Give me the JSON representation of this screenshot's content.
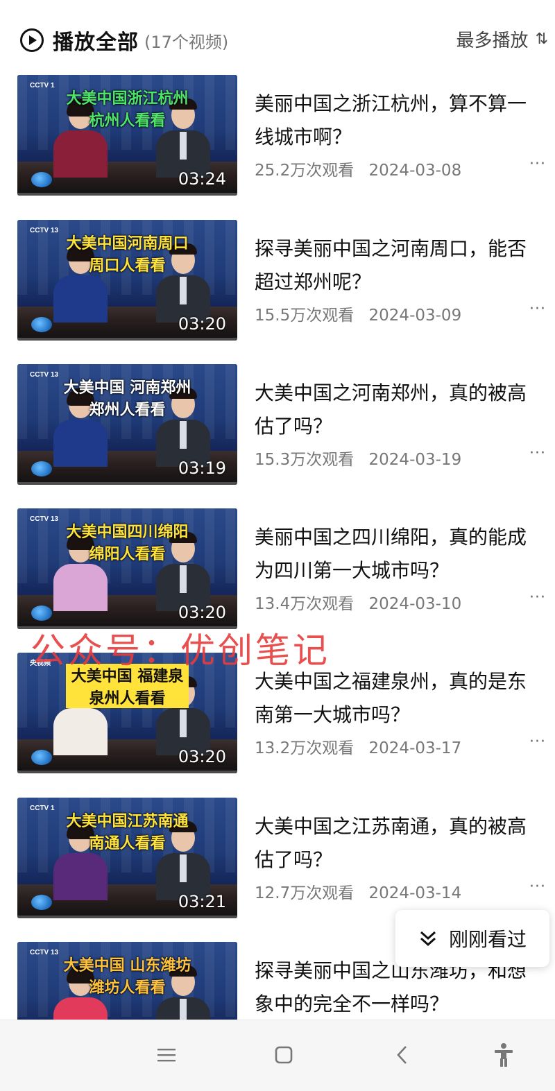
{
  "header": {
    "play_all_label": "播放全部",
    "count_label": "(17个视频)",
    "sort_label": "最多播放",
    "sort_icon": "⇅"
  },
  "videos": [
    {
      "title": "美丽中国之浙江杭州，算不算一线城市啊？",
      "views": "25.2万次观看",
      "date": "2024-03-08",
      "duration": "03:24",
      "caption_line1": "大美中国浙江杭州",
      "caption_line2": "杭州人看看",
      "caption_color": "#4ee66a",
      "channel": "CCTV 1",
      "anchor_color": "#8a1f3a"
    },
    {
      "title": "探寻美丽中国之河南周口，能否超过郑州呢？",
      "views": "15.5万次观看",
      "date": "2024-03-09",
      "duration": "03:20",
      "caption_line1": "大美中国河南周口",
      "caption_line2": "周口人看看",
      "caption_color": "#ffe23a",
      "channel": "CCTV 13",
      "anchor_color": "#1f3a8a"
    },
    {
      "title": "大美中国之河南郑州，真的被高估了吗？",
      "views": "15.3万次观看",
      "date": "2024-03-19",
      "duration": "03:19",
      "caption_line1": "大美中国 河南郑州",
      "caption_line2": "郑州人看看",
      "caption_color": "#ffffff",
      "channel": "CCTV 13",
      "anchor_color": "#1f3a8a"
    },
    {
      "title": "美丽中国之四川绵阳，真的能成为四川第一大城市吗？",
      "views": "13.4万次观看",
      "date": "2024-03-10",
      "duration": "03:20",
      "caption_line1": "大美中国四川绵阳",
      "caption_line2": "绵阳人看看",
      "caption_color": "#ffe23a",
      "channel": "CCTV 13",
      "anchor_color": "#d9a6d6"
    },
    {
      "title": "大美中国之福建泉州，真的是东南第一大城市吗？",
      "views": "13.2万次观看",
      "date": "2024-03-17",
      "duration": "03:20",
      "caption_line1": "大美中国 福建泉州",
      "caption_line2": "泉州人看看",
      "caption_color": "#111111",
      "channel": "央视频",
      "anchor_color": "#f1ece6"
    },
    {
      "title": "大美中国之江苏南通，真的被高估了吗？",
      "views": "12.7万次观看",
      "date": "2024-03-14",
      "duration": "03:21",
      "caption_line1": "大美中国江苏南通",
      "caption_line2": "南通人看看",
      "caption_color": "#ffe23a",
      "channel": "CCTV 1",
      "anchor_color": "#5a2a7a"
    },
    {
      "title": "探寻美丽中国之山东潍坊，和想象中的完全不一样吗？",
      "views": "",
      "date": "",
      "duration": "",
      "caption_line1": "大美中国 山东潍坊",
      "caption_line2": "潍坊人看看",
      "caption_color": "#ffc23a",
      "channel": "CCTV 13",
      "anchor_color": "#e23a5a"
    }
  ],
  "more_icon": "···",
  "watermark": "公众号：优创笔记",
  "recent": {
    "label": "刚刚看过",
    "icon": "double-chevron-down-icon"
  },
  "nav": {
    "items": [
      "menu-icon",
      "home-icon",
      "back-icon",
      "accessibility-icon"
    ]
  }
}
